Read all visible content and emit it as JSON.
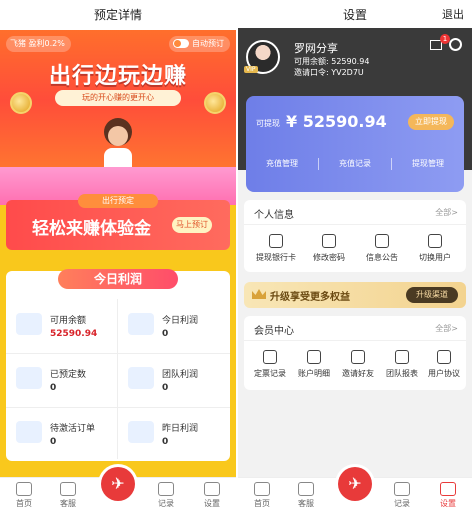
{
  "left": {
    "title": "预定详情",
    "hero": {
      "user_pill": "飞猪 盈利0.2%",
      "auto_pill": "自动预订",
      "title": "出行边玩边赚",
      "subtitle": "玩的开心赚的更开心"
    },
    "promo": {
      "tag": "出行预定",
      "text": "轻松来赚体验金",
      "button": "马上预订"
    },
    "today": {
      "title": "今日利润",
      "cells": [
        {
          "label": "可用余额",
          "value": "52590.94",
          "highlight": true
        },
        {
          "label": "今日利润",
          "value": "0",
          "highlight": false
        },
        {
          "label": "已预定数",
          "value": "0",
          "highlight": false
        },
        {
          "label": "团队利润",
          "value": "0",
          "highlight": false
        },
        {
          "label": "待激活订单",
          "value": "0",
          "highlight": false
        },
        {
          "label": "昨日利润",
          "value": "0",
          "highlight": false
        }
      ]
    },
    "nav": [
      {
        "label": "首页",
        "icon": "home-icon"
      },
      {
        "label": "客服",
        "icon": "service-icon"
      },
      {
        "label": "",
        "icon": "center-fab-icon"
      },
      {
        "label": "记录",
        "icon": "record-icon"
      },
      {
        "label": "设置",
        "icon": "settings-icon"
      }
    ]
  },
  "right": {
    "title": "设置",
    "logout": "退出",
    "user": {
      "name": "罗网分享",
      "balance_line": "可用余额: 52590.94",
      "invite_line": "邀请口令: YV2D7U",
      "vip": "VIP",
      "message_count": "1"
    },
    "balance_card": {
      "label": "可提现",
      "value": "¥ 52590.94",
      "withdraw_button": "立即提现",
      "links": [
        "充值管理",
        "充值记录",
        "提现管理"
      ]
    },
    "personal": {
      "title": "个人信息",
      "more": "全部>",
      "items": [
        "提现银行卡",
        "修改密码",
        "信息公告",
        "切换用户"
      ]
    },
    "upgrade": {
      "text": "升级享受更多权益",
      "button": "升级渠道"
    },
    "member": {
      "title": "会员中心",
      "more": "全部>",
      "items": [
        "定票记录",
        "账户明细",
        "邀请好友",
        "团队报表",
        "用户协议"
      ]
    },
    "nav": [
      {
        "label": "首页",
        "icon": "home-icon"
      },
      {
        "label": "客服",
        "icon": "service-icon"
      },
      {
        "label": "",
        "icon": "center-fab-icon"
      },
      {
        "label": "记录",
        "icon": "record-icon"
      },
      {
        "label": "设置",
        "icon": "settings-icon"
      }
    ]
  },
  "colors": {
    "brand_red": "#e83a3a",
    "yellow_bg": "#f9c81c",
    "dark_header": "#3a3a3a",
    "card_blue": "#7b89ec",
    "gold": "#f4b75a"
  }
}
